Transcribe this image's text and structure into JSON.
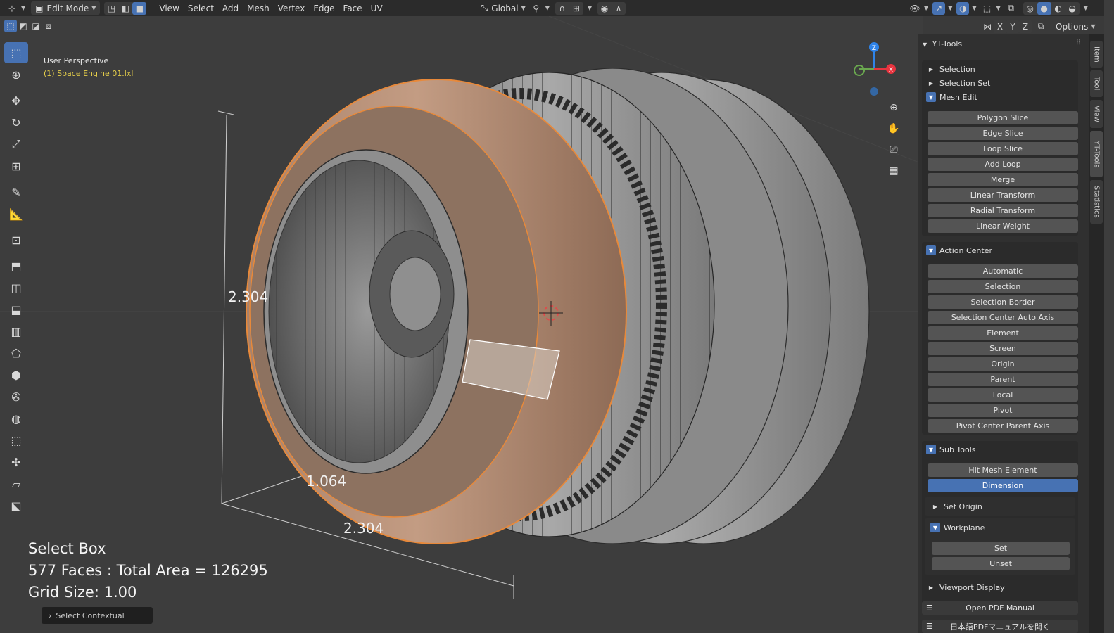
{
  "header": {
    "mode": "Edit Mode",
    "menus": [
      "View",
      "Select",
      "Add",
      "Mesh",
      "Vertex",
      "Edge",
      "Face",
      "UV"
    ],
    "orientation": "Global",
    "options_label": "Options",
    "axes": [
      "X",
      "Y",
      "Z"
    ]
  },
  "viewport": {
    "view_name": "User Perspective",
    "object_name": "(1) Space Engine 01.lxl",
    "dimensions": {
      "height": "2.304",
      "depth": "1.064",
      "width": "2.304"
    },
    "overlay": {
      "tool": "Select Box",
      "stats": "577 Faces : Total Area = 126295",
      "grid": "Grid Size: 1.00"
    },
    "select_contextual": "Select Contextual",
    "gizmo": {
      "x": "X",
      "y": "Y",
      "z": "Z"
    }
  },
  "sidebar": {
    "title": "YT-Tools",
    "sections": {
      "selection": "Selection",
      "selection_set": "Selection Set",
      "mesh_edit": "Mesh Edit",
      "mesh_edit_buttons": [
        "Polygon Slice",
        "Edge Slice",
        "Loop Slice",
        "Add Loop",
        "Merge",
        "Linear Transform",
        "Radial Transform",
        "Linear Weight"
      ],
      "action_center": "Action Center",
      "action_center_buttons": [
        "Automatic",
        "Selection",
        "Selection Border",
        "Selection Center Auto Axis",
        "Element",
        "Screen",
        "Origin",
        "Parent",
        "Local",
        "Pivot",
        "Pivot Center Parent Axis"
      ],
      "sub_tools": "Sub Tools",
      "hit_mesh_element": "Hit Mesh Element",
      "dimension": "Dimension",
      "set_origin": "Set Origin",
      "workplane": "Workplane",
      "set": "Set",
      "unset": "Unset",
      "viewport_display": "Viewport Display",
      "open_pdf": "Open PDF Manual",
      "jp_pdf": "日本語PDFマニュアルを開く"
    }
  },
  "tabs": [
    "Item",
    "Tool",
    "View",
    "YT-Tools",
    "Statistics"
  ],
  "colors": {
    "accent": "#4772b3",
    "selection_orange": "#e8893a",
    "panel_bg": "#303030",
    "viewport_bg": "#3d3d3d",
    "axis_x": "#e8343f",
    "axis_y": "#6aa84f",
    "axis_z": "#2f83e8"
  }
}
